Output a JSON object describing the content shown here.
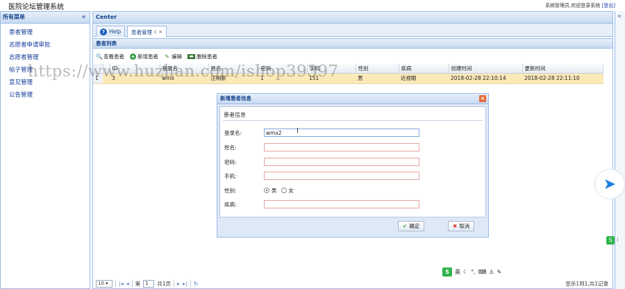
{
  "header": {
    "title": "医院论坛管理系统",
    "welcome": "系统管理员,欢迎登录系统",
    "logout": "[登出]"
  },
  "west": {
    "title": "所有菜单",
    "collapse_icon": "«",
    "items": [
      {
        "label": "患者管理"
      },
      {
        "label": "志愿者申请审批"
      },
      {
        "label": "志愿者管理"
      },
      {
        "label": "帖子管理"
      },
      {
        "label": "意见管理"
      },
      {
        "label": "公告管理"
      }
    ]
  },
  "center": {
    "title": "Center",
    "tabs": [
      {
        "label": "Help",
        "icon": "help-icon"
      },
      {
        "label": "患者管理",
        "close": "c ×"
      }
    ],
    "list_title": "患者列表",
    "toolbar": {
      "view": "查看患者",
      "add": "新增患者",
      "edit": "编辑",
      "delete": "删除患者"
    },
    "grid": {
      "columns": [
        "ID",
        "登录名",
        "姓名",
        "密码",
        "手机",
        "性别",
        "疾病",
        "创建时间",
        "更新时间"
      ],
      "rows": [
        {
          "rownum": "1",
          "id": "3",
          "login": "wmx",
          "name": "汪明新",
          "password": "1",
          "phone": "151",
          "gender": "男",
          "disease": "近视眼",
          "created": "2018-02-28 22:10:14",
          "updated": "2018-02-28 22:11:10"
        }
      ]
    },
    "pager": {
      "page_size": "10 ▾",
      "page_prefix": "第",
      "page": "1",
      "page_suffix": "共1页",
      "info": "显示1到1,共1记录"
    }
  },
  "dialog": {
    "title": "新增患者信息",
    "close_icon": "×",
    "section": "患者信息",
    "fields": {
      "login_label": "登录名:",
      "login_value": "wmx2",
      "name_label": "姓名:",
      "password_label": "密码:",
      "phone_label": "手机:",
      "gender_label": "性别:",
      "gender_male": "男",
      "gender_female": "女",
      "disease_label": "疾病:"
    },
    "confirm": "确定",
    "cancel": "取消"
  },
  "ime": {
    "logo": "S",
    "lang": "英"
  },
  "watermark": "https://www.huzhan.com/ishop39397",
  "colors": {
    "panel_border": "#99bbe8",
    "panel_title": "#15428b",
    "row_selected": "#fbe9b8",
    "invalid_border": "#e8a0a0"
  }
}
